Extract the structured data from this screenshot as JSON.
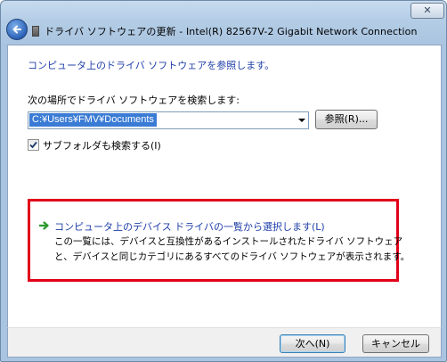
{
  "window": {
    "close_glyph": "✕"
  },
  "header": {
    "title": "ドライバ ソフトウェアの更新 - Intel(R) 82567V-2 Gigabit Network Connection",
    "back_icon": "back-arrow-icon",
    "device_icon": "network-device-icon"
  },
  "main": {
    "heading": "コンピュータ上のドライバ ソフトウェアを参照します。",
    "search_label": "次の場所でドライバ ソフトウェアを検索します:",
    "path_value": "C:¥Users¥FMV¥Documents",
    "browse_label": "参照(R)...",
    "include_subfolders_label": "サブフォルダも検索する(I)",
    "include_subfolders_checked": true,
    "option": {
      "title": "コンピュータ上のデバイス ドライバの一覧から選択します(L)",
      "description_line1": "この一覧には、デバイスと互換性があるインストールされたドライバ ソフトウェア",
      "description_line2": "と、デバイスと同じカテゴリにあるすべてのドライバ ソフトウェアが表示されます。",
      "icon": "green-arrow-icon"
    },
    "highlight_color": "#e2001a"
  },
  "footer": {
    "next_label": "次へ(N)",
    "cancel_label": "キャンセル"
  }
}
